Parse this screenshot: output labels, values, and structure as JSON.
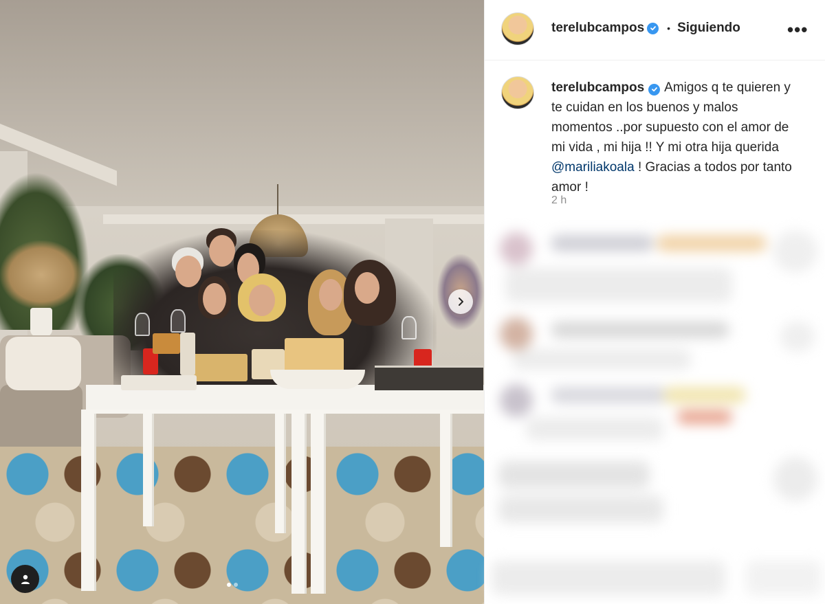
{
  "post": {
    "author": "terelubcampos",
    "follow_status": "Siguiendo",
    "bullet": "•",
    "more_glyph": "•••",
    "caption_before_mention": "Amigos q te quieren y te cuidan en los buenos y malos momentos ..por supuesto con el amor de mi vida , mi hija !! Y mi otra hija querida",
    "mention": "@mariliakoala",
    "caption_after_mention": " ! Gracias a todos por tanto amor !",
    "time_ago": "2 h",
    "verified_icon": "verified-badge-icon",
    "carousel": {
      "slide_count": 2,
      "active_index": 0
    }
  },
  "icons": {
    "next": "chevron-right-icon",
    "tag": "user-tag-icon"
  },
  "colors": {
    "accent_link": "#00376b",
    "verified": "#3897f0",
    "muted": "#8e8e8e"
  }
}
